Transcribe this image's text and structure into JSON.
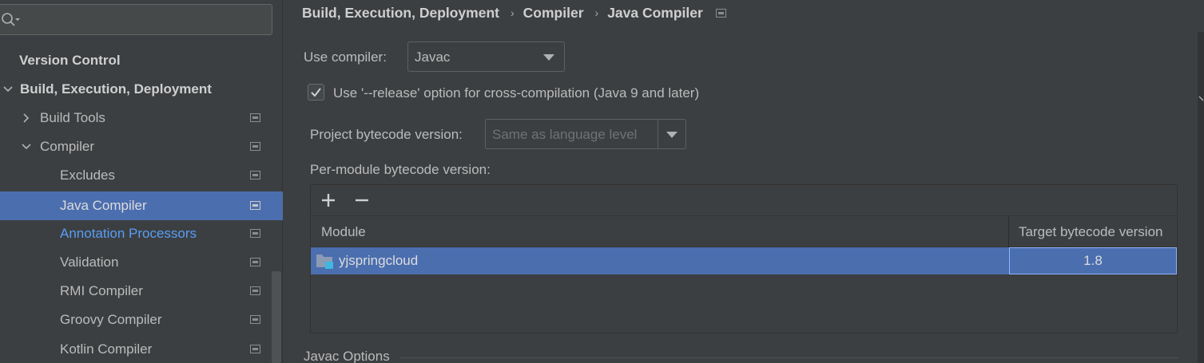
{
  "search": {
    "placeholder": ""
  },
  "sidebar": {
    "items": [
      {
        "label": "Version Control"
      },
      {
        "label": "Build, Execution, Deployment"
      },
      {
        "label": "Build Tools"
      },
      {
        "label": "Compiler"
      },
      {
        "label": "Excludes"
      },
      {
        "label": "Java Compiler"
      },
      {
        "label": "Annotation Processors"
      },
      {
        "label": "Validation"
      },
      {
        "label": "RMI Compiler"
      },
      {
        "label": "Groovy Compiler"
      },
      {
        "label": "Kotlin Compiler"
      }
    ],
    "selected_item": "Java Compiler"
  },
  "breadcrumb": {
    "items": [
      "Build, Execution, Deployment",
      "Compiler",
      "Java Compiler"
    ],
    "separator": "›"
  },
  "form": {
    "use_compiler_label": "Use compiler:",
    "use_compiler_value": "Javac",
    "release_option_label": "Use '--release' option for cross-compilation (Java 9 and later)",
    "release_option_checked": true,
    "project_bytecode_label": "Project bytecode version:",
    "project_bytecode_value": "Same as language level",
    "per_module_label": "Per-module bytecode version:"
  },
  "table": {
    "toolbar": {
      "add": "+",
      "remove": "−"
    },
    "columns": [
      "Module",
      "Target bytecode version"
    ],
    "rows": [
      {
        "module": "yjspringcloud",
        "version": "1.8",
        "selected": true
      }
    ]
  },
  "sections": {
    "javac_options": "Javac Options"
  },
  "colors": {
    "background": "#3c3f41",
    "selection": "#4b6eaf",
    "link": "#589df6",
    "text": "#bbbbbb"
  },
  "icons": {
    "search": "search-icon",
    "expand": "chevron-right-icon",
    "collapse": "chevron-down-icon",
    "project_level": "project-settings-icon",
    "dropdown": "caret-down-icon",
    "check": "checkmark-icon",
    "module": "module-folder-icon"
  }
}
